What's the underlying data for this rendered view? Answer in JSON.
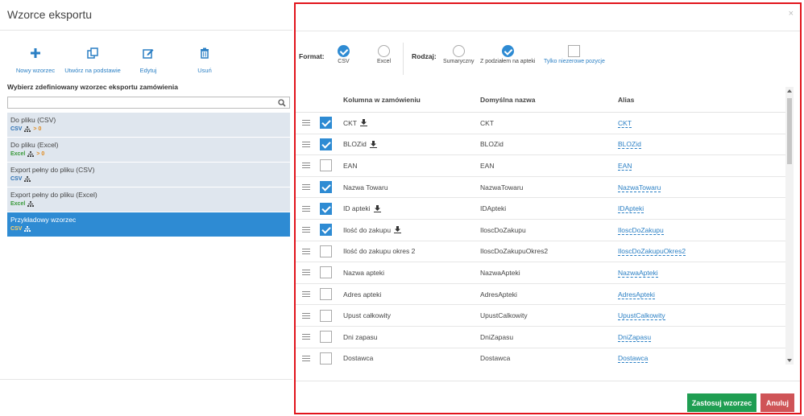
{
  "left": {
    "title": "Wzorce eksportu",
    "toolbar": [
      {
        "label": "Nowy wzorzec",
        "icon": "plus-icon"
      },
      {
        "label": "Utwórz na podstawie",
        "icon": "copy-icon"
      },
      {
        "label": "Edytuj",
        "icon": "edit-icon"
      },
      {
        "label": "Usuń",
        "icon": "trash-icon"
      }
    ],
    "choose_label": "Wybierz zdefiniowany wzorzec eksportu zamówienia",
    "search_value": "",
    "templates": [
      {
        "name": "Do pliku (CSV)",
        "format": "CSV",
        "extra": "> 0",
        "selected": false
      },
      {
        "name": "Do pliku (Excel)",
        "format": "Excel",
        "extra": "> 0",
        "selected": false
      },
      {
        "name": "Export pełny do pliku (CSV)",
        "format": "CSV",
        "extra": "",
        "selected": false
      },
      {
        "name": "Export pełny do pliku (Excel)",
        "format": "Excel",
        "extra": "",
        "selected": false
      },
      {
        "name": "Przykładowy wzorzec",
        "format": "CSV",
        "extra": "",
        "selected": true
      }
    ]
  },
  "modal": {
    "close": "×",
    "format_label": "Format:",
    "format_csv": "CSV",
    "format_excel": "Excel",
    "kind_label": "Rodzaj:",
    "kind_summary": "Sumaryczny",
    "kind_by_pharmacy": "Z podziałem na apteki",
    "only_nonzero": "Tylko niezerowe pozycje",
    "table": {
      "headers": {
        "column": "Kolumna w zamówieniu",
        "default": "Domyślna nazwa",
        "alias": "Alias"
      },
      "rows": [
        {
          "column": "CKT",
          "default": "CKT",
          "alias": "CKT",
          "checked": true,
          "download": true
        },
        {
          "column": "BLOZid",
          "default": "BLOZid",
          "alias": "BLOZid",
          "checked": true,
          "download": true
        },
        {
          "column": "EAN",
          "default": "EAN",
          "alias": "EAN",
          "checked": false,
          "download": false
        },
        {
          "column": "Nazwa Towaru",
          "default": "NazwaTowaru",
          "alias": "NazwaTowaru",
          "checked": true,
          "download": false
        },
        {
          "column": "ID apteki",
          "default": "IDApteki",
          "alias": "IDApteki",
          "checked": true,
          "download": true
        },
        {
          "column": "Ilość do zakupu",
          "default": "IloscDoZakupu",
          "alias": "IloscDoZakupu",
          "checked": true,
          "download": true
        },
        {
          "column": "Ilość do zakupu okres 2",
          "default": "IloscDoZakupuOkres2",
          "alias": "IloscDoZakupuOkres2",
          "checked": false,
          "download": false
        },
        {
          "column": "Nazwa apteki",
          "default": "NazwaApteki",
          "alias": "NazwaApteki",
          "checked": false,
          "download": false
        },
        {
          "column": "Adres apteki",
          "default": "AdresApteki",
          "alias": "AdresApteki",
          "checked": false,
          "download": false
        },
        {
          "column": "Upust całkowity",
          "default": "UpustCalkowity",
          "alias": "UpustCalkowity",
          "checked": false,
          "download": false
        },
        {
          "column": "Dni zapasu",
          "default": "DniZapasu",
          "alias": "DniZapasu",
          "checked": false,
          "download": false
        },
        {
          "column": "Dostawca",
          "default": "Dostawca",
          "alias": "Dostawca",
          "checked": false,
          "download": false
        }
      ]
    },
    "apply_label": "Zastosuj wzorzec",
    "cancel_label": "Anuluj"
  },
  "colors": {
    "accent": "#2e8bd3",
    "apply": "#1f9e52",
    "cancel": "#cf5457",
    "frame": "#e1141c"
  }
}
